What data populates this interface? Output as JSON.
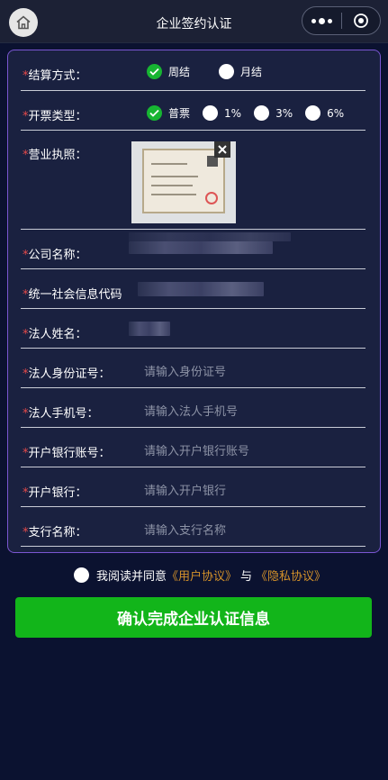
{
  "header": {
    "title": "企业签约认证",
    "home_icon": "home-icon",
    "more_icon": "more-dots-icon",
    "close_icon": "record-close-icon"
  },
  "form": {
    "settlement": {
      "label": "结算方式：",
      "required": "*",
      "options": [
        {
          "label": "周结",
          "checked": true
        },
        {
          "label": "月结",
          "checked": false
        }
      ]
    },
    "invoice": {
      "label": "开票类型：",
      "required": "*",
      "options": [
        {
          "label": "普票",
          "checked": true
        },
        {
          "label": "1%",
          "checked": false
        },
        {
          "label": "3%",
          "checked": false
        },
        {
          "label": "6%",
          "checked": false
        }
      ]
    },
    "license": {
      "label": "营业执照：",
      "required": "*",
      "image": "business-license-photo",
      "delete_icon": "close-icon"
    },
    "company_name": {
      "label": "公司名称：",
      "required": "*",
      "value_redacted": true
    },
    "credit_code": {
      "label": "统一社会信息代码",
      "required": "*",
      "value_redacted": true
    },
    "legal_name": {
      "label": "法人姓名：",
      "required": "*",
      "value_redacted": true
    },
    "legal_id": {
      "label": "法人身份证号：",
      "required": "*",
      "placeholder": "请输入身份证号"
    },
    "legal_phone": {
      "label": "法人手机号：",
      "required": "*",
      "placeholder": "请输入法人手机号"
    },
    "bank_account": {
      "label": "开户银行账号：",
      "required": "*",
      "placeholder": "请输入开户银行账号"
    },
    "bank": {
      "label": "开户银行：",
      "required": "*",
      "placeholder": "请输入开户银行"
    },
    "branch": {
      "label": "支行名称：",
      "required": "*",
      "placeholder": "请输入支行名称"
    }
  },
  "agreement": {
    "prefix": "我阅读并同意",
    "user_agreement": "《用户协议》",
    "and": "与",
    "privacy_agreement": "《隐私协议》",
    "checked": false
  },
  "submit_label": "确认完成企业认证信息",
  "colors": {
    "background": "#0b1230",
    "card_border": "#7a56d2",
    "accent_green": "#12b51a",
    "required_red": "#e84a4a",
    "link_orange": "#d3912a"
  }
}
